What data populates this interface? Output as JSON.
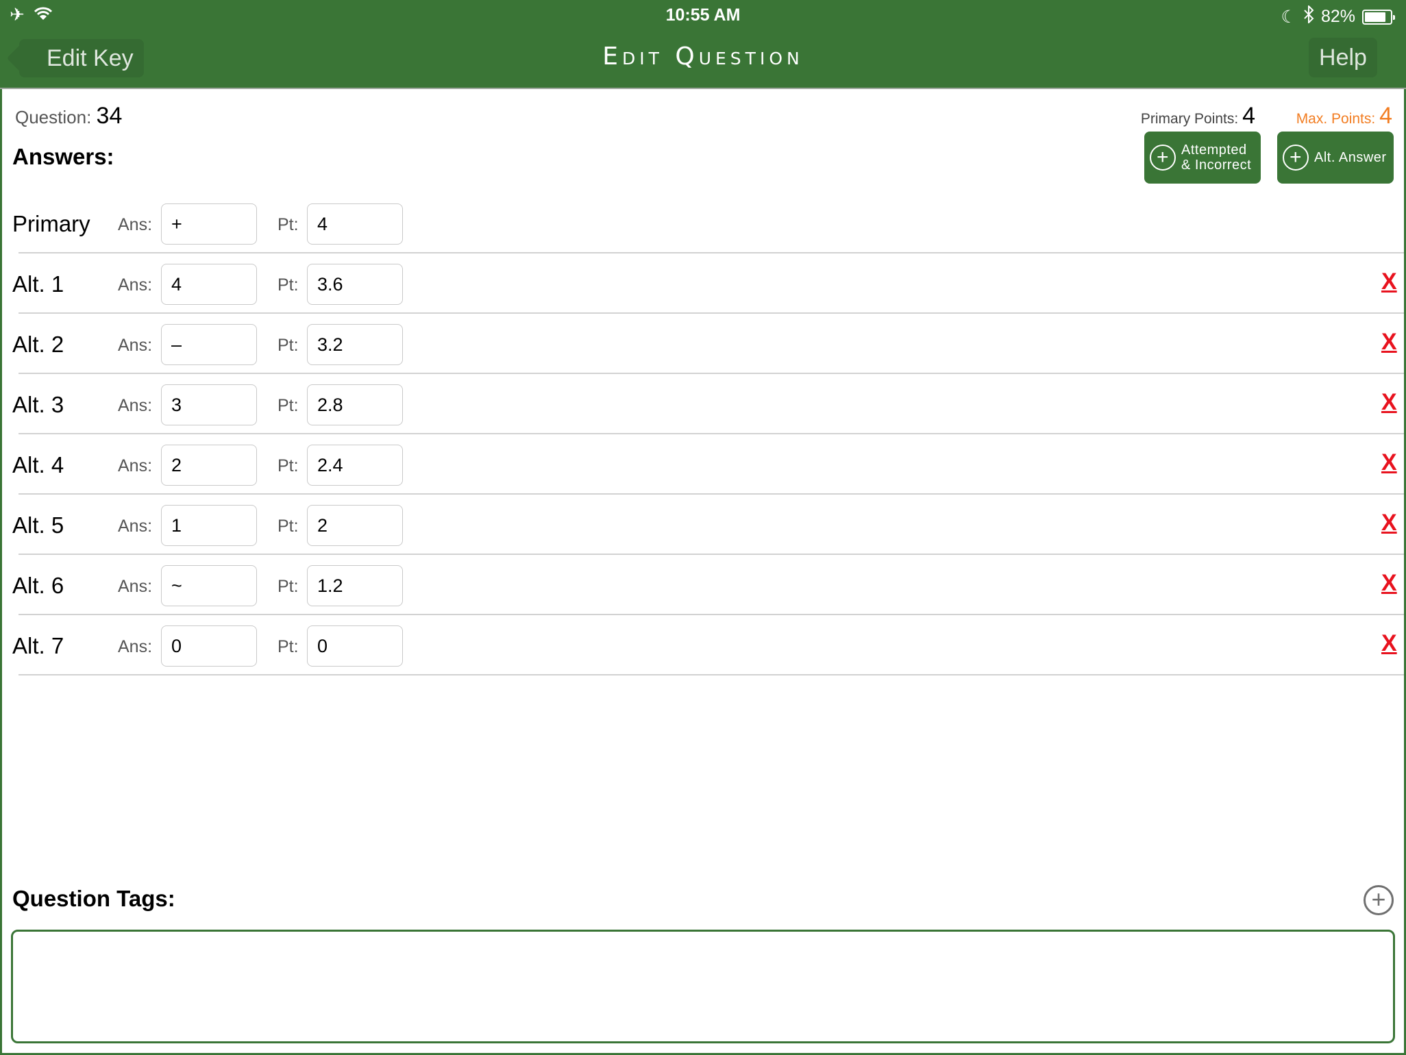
{
  "status_bar": {
    "time": "10:55 AM",
    "battery": "82%",
    "battery_level": 0.82,
    "icons_left": [
      "airplane-icon",
      "wifi-icon"
    ],
    "icons_right": [
      "moon-icon",
      "bluetooth-icon",
      "battery-icon"
    ]
  },
  "nav": {
    "back_label": "Edit Key",
    "title": "Edit Question",
    "help_label": "Help"
  },
  "question": {
    "label": "Question:",
    "number": "34",
    "primary_points_label": "Primary Points:",
    "primary_points": "4",
    "max_points_label": "Max. Points:",
    "max_points": "4"
  },
  "answers": {
    "heading": "Answers:",
    "attempted_button": "Attempted & Incorrect",
    "attempted_line1": "Attempted",
    "attempted_line2": "& Incorrect",
    "alt_button": "Alt. Answer",
    "ans_label": "Ans:",
    "pt_label": "Pt:",
    "delete_label": "X",
    "rows": [
      {
        "name": "Primary",
        "ans": "+",
        "pt": "4",
        "deletable": false
      },
      {
        "name": "Alt. 1",
        "ans": "4",
        "pt": "3.6",
        "deletable": true
      },
      {
        "name": "Alt. 2",
        "ans": "–",
        "pt": "3.2",
        "deletable": true
      },
      {
        "name": "Alt. 3",
        "ans": "3",
        "pt": "2.8",
        "deletable": true
      },
      {
        "name": "Alt. 4",
        "ans": "2",
        "pt": "2.4",
        "deletable": true
      },
      {
        "name": "Alt. 5",
        "ans": "1",
        "pt": "2",
        "deletable": true
      },
      {
        "name": "Alt. 6",
        "ans": "~",
        "pt": "1.2",
        "deletable": true
      },
      {
        "name": "Alt. 7",
        "ans": "0",
        "pt": "0",
        "deletable": true
      }
    ]
  },
  "tags": {
    "heading": "Question Tags:",
    "value": ""
  },
  "colors": {
    "brand_green": "#3a7536",
    "max_points_orange": "#f27d22",
    "delete_red": "#e8121e"
  }
}
